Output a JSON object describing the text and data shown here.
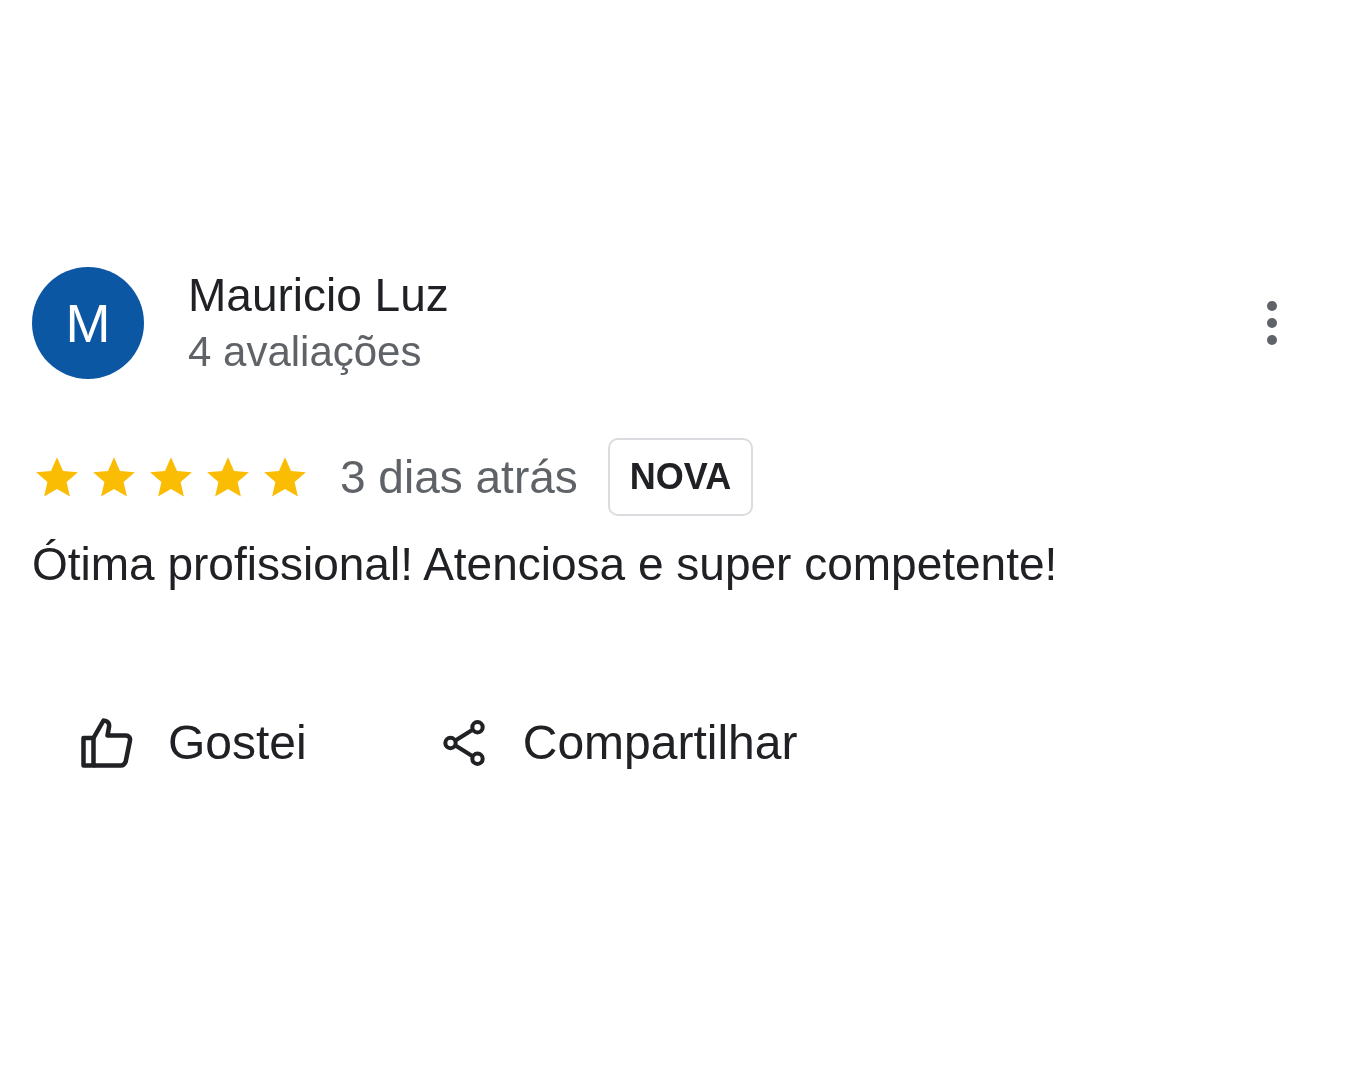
{
  "review": {
    "avatar_letter": "M",
    "author": "Mauricio Luz",
    "reviews_count": "4 avaliações",
    "stars": 5,
    "time": "3 dias atrás",
    "badge": "NOVA",
    "text": "Ótima profissional! Atenciosa e super competente!",
    "actions": [
      {
        "kind": "like",
        "label": "Gostei"
      },
      {
        "kind": "share",
        "label": "Compartilhar"
      }
    ]
  }
}
